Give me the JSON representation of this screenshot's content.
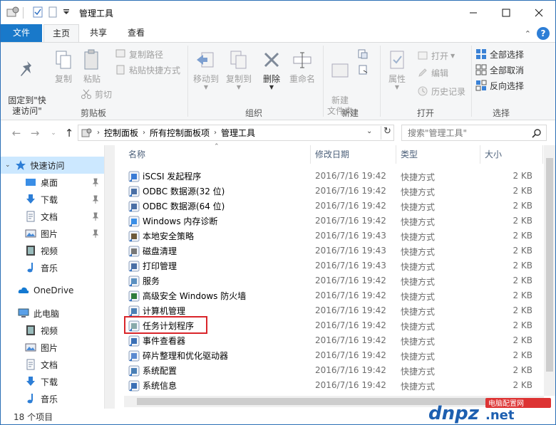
{
  "window": {
    "title": "管理工具"
  },
  "tabs": {
    "file": "文件",
    "home": "主页",
    "share": "共享",
    "view": "查看"
  },
  "ribbon": {
    "clipboard": {
      "label": "剪贴板",
      "pin_quick": "固定到\"快\n速访问\"",
      "copy": "复制",
      "paste": "粘贴",
      "copy_path": "复制路径",
      "paste_shortcut": "粘贴快捷方式",
      "cut": "剪切"
    },
    "organize": {
      "label": "组织",
      "move_to": "移动到",
      "copy_to": "复制到",
      "delete": "删除",
      "rename": "重命名"
    },
    "new": {
      "label": "新建",
      "new_folder": "新建\n文件夹"
    },
    "open": {
      "label": "打开",
      "properties": "属性",
      "open": "打开",
      "edit": "编辑",
      "history": "历史记录"
    },
    "select": {
      "label": "选择",
      "select_all": "全部选择",
      "select_none": "全部取消",
      "invert": "反向选择"
    }
  },
  "address": {
    "crumbs": [
      "控制面板",
      "所有控制面板项",
      "管理工具"
    ],
    "search_placeholder": "搜索\"管理工具\""
  },
  "nav_pane": {
    "quick_access": "快速访问",
    "items": [
      "桌面",
      "下载",
      "文档",
      "图片",
      "视频",
      "音乐"
    ],
    "onedrive": "OneDrive",
    "this_pc": "此电脑",
    "pc_items": [
      "视频",
      "图片",
      "文档",
      "下载",
      "音乐"
    ]
  },
  "columns": {
    "name": "名称",
    "date": "修改日期",
    "type": "类型",
    "size": "大小"
  },
  "files": [
    {
      "name": "iSCSI 发起程序",
      "date": "2016/7/16 19:42",
      "type": "快捷方式",
      "size": "2 KB"
    },
    {
      "name": "ODBC 数据源(32 位)",
      "date": "2016/7/16 19:42",
      "type": "快捷方式",
      "size": "2 KB"
    },
    {
      "name": "ODBC 数据源(64 位)",
      "date": "2016/7/16 19:42",
      "type": "快捷方式",
      "size": "2 KB"
    },
    {
      "name": "Windows 内存诊断",
      "date": "2016/7/16 19:42",
      "type": "快捷方式",
      "size": "2 KB"
    },
    {
      "name": "本地安全策略",
      "date": "2016/7/16 19:43",
      "type": "快捷方式",
      "size": "2 KB"
    },
    {
      "name": "磁盘清理",
      "date": "2016/7/16 19:43",
      "type": "快捷方式",
      "size": "2 KB"
    },
    {
      "name": "打印管理",
      "date": "2016/7/16 19:43",
      "type": "快捷方式",
      "size": "2 KB"
    },
    {
      "name": "服务",
      "date": "2016/7/16 19:42",
      "type": "快捷方式",
      "size": "2 KB"
    },
    {
      "name": "高级安全 Windows 防火墙",
      "date": "2016/7/16 19:42",
      "type": "快捷方式",
      "size": "2 KB"
    },
    {
      "name": "计算机管理",
      "date": "2016/7/16 19:42",
      "type": "快捷方式",
      "size": "2 KB"
    },
    {
      "name": "任务计划程序",
      "date": "2016/7/16 19:42",
      "type": "快捷方式",
      "size": "2 KB"
    },
    {
      "name": "事件查看器",
      "date": "2016/7/16 19:42",
      "type": "快捷方式",
      "size": "2 KB"
    },
    {
      "name": "碎片整理和优化驱动器",
      "date": "2016/7/16 19:42",
      "type": "快捷方式",
      "size": "2 KB"
    },
    {
      "name": "系统配置",
      "date": "2016/7/16 19:42",
      "type": "快捷方式",
      "size": "2 KB"
    },
    {
      "name": "系统信息",
      "date": "2016/7/16 19:42",
      "type": "快捷方式",
      "size": "2 KB"
    }
  ],
  "status": {
    "count": "18 个项目"
  },
  "watermark": {
    "brand": "dnpz.net",
    "tagline": "电脑配置网"
  }
}
